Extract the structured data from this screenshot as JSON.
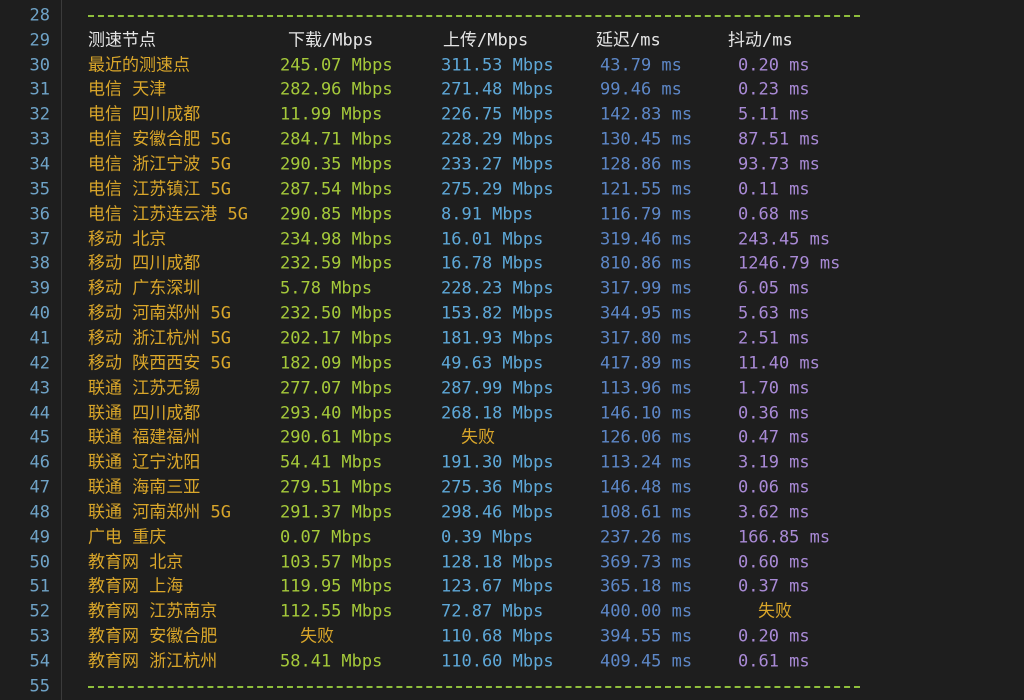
{
  "header": {
    "line": "29",
    "node": "测速节点",
    "download": "下载/Mbps",
    "upload": "上传/Mbps",
    "latency": "延迟/ms",
    "jitter": "抖动/ms"
  },
  "separator_lines": [
    "28",
    "55"
  ],
  "rows": [
    {
      "line": "30",
      "node": "最近的测速点",
      "download": "245.07 Mbps",
      "upload": "311.53 Mbps",
      "latency": "43.79 ms",
      "jitter": "0.20 ms"
    },
    {
      "line": "31",
      "node": "电信 天津",
      "download": "282.96 Mbps",
      "upload": "271.48 Mbps",
      "latency": "99.46 ms",
      "jitter": "0.23 ms"
    },
    {
      "line": "32",
      "node": "电信 四川成都",
      "download": "11.99 Mbps",
      "upload": "226.75 Mbps",
      "latency": "142.83 ms",
      "jitter": "5.11 ms"
    },
    {
      "line": "33",
      "node": "电信 安徽合肥 5G",
      "download": "284.71 Mbps",
      "upload": "228.29 Mbps",
      "latency": "130.45 ms",
      "jitter": "87.51 ms"
    },
    {
      "line": "34",
      "node": "电信 浙江宁波 5G",
      "download": "290.35 Mbps",
      "upload": "233.27 Mbps",
      "latency": "128.86 ms",
      "jitter": "93.73 ms"
    },
    {
      "line": "35",
      "node": "电信 江苏镇江 5G",
      "download": "287.54 Mbps",
      "upload": "275.29 Mbps",
      "latency": "121.55 ms",
      "jitter": "0.11 ms"
    },
    {
      "line": "36",
      "node": "电信 江苏连云港 5G",
      "download": "290.85 Mbps",
      "upload": "8.91 Mbps",
      "latency": "116.79 ms",
      "jitter": "0.68 ms"
    },
    {
      "line": "37",
      "node": "移动 北京",
      "download": "234.98 Mbps",
      "upload": "16.01 Mbps",
      "latency": "319.46 ms",
      "jitter": "243.45 ms"
    },
    {
      "line": "38",
      "node": "移动 四川成都",
      "download": "232.59 Mbps",
      "upload": "16.78 Mbps",
      "latency": "810.86 ms",
      "jitter": "1246.79 ms"
    },
    {
      "line": "39",
      "node": "移动 广东深圳",
      "download": "5.78 Mbps",
      "upload": "228.23 Mbps",
      "latency": "317.99 ms",
      "jitter": "6.05 ms"
    },
    {
      "line": "40",
      "node": "移动 河南郑州 5G",
      "download": "232.50 Mbps",
      "upload": "153.82 Mbps",
      "latency": "344.95 ms",
      "jitter": "5.63 ms"
    },
    {
      "line": "41",
      "node": "移动 浙江杭州 5G",
      "download": "202.17 Mbps",
      "upload": "181.93 Mbps",
      "latency": "317.80 ms",
      "jitter": "2.51 ms"
    },
    {
      "line": "42",
      "node": "移动 陕西西安 5G",
      "download": "182.09 Mbps",
      "upload": "49.63 Mbps",
      "latency": "417.89 ms",
      "jitter": "11.40 ms"
    },
    {
      "line": "43",
      "node": "联通 江苏无锡",
      "download": "277.07 Mbps",
      "upload": "287.99 Mbps",
      "latency": "113.96 ms",
      "jitter": "1.70 ms"
    },
    {
      "line": "44",
      "node": "联通 四川成都",
      "download": "293.40 Mbps",
      "upload": "268.18 Mbps",
      "latency": "146.10 ms",
      "jitter": "0.36 ms"
    },
    {
      "line": "45",
      "node": "联通 福建福州",
      "download": "290.61 Mbps",
      "upload": "失败",
      "latency": "126.06 ms",
      "jitter": "0.47 ms"
    },
    {
      "line": "46",
      "node": "联通 辽宁沈阳",
      "download": "54.41 Mbps",
      "upload": "191.30 Mbps",
      "latency": "113.24 ms",
      "jitter": "3.19 ms"
    },
    {
      "line": "47",
      "node": "联通 海南三亚",
      "download": "279.51 Mbps",
      "upload": "275.36 Mbps",
      "latency": "146.48 ms",
      "jitter": "0.06 ms"
    },
    {
      "line": "48",
      "node": "联通 河南郑州 5G",
      "download": "291.37 Mbps",
      "upload": "298.46 Mbps",
      "latency": "108.61 ms",
      "jitter": "3.62 ms"
    },
    {
      "line": "49",
      "node": "广电 重庆",
      "download": "0.07 Mbps",
      "upload": "0.39 Mbps",
      "latency": "237.26 ms",
      "jitter": "166.85 ms"
    },
    {
      "line": "50",
      "node": "教育网 北京",
      "download": "103.57 Mbps",
      "upload": "128.18 Mbps",
      "latency": "369.73 ms",
      "jitter": "0.60 ms"
    },
    {
      "line": "51",
      "node": "教育网 上海",
      "download": "119.95 Mbps",
      "upload": "123.67 Mbps",
      "latency": "365.18 ms",
      "jitter": "0.37 ms"
    },
    {
      "line": "52",
      "node": "教育网 江苏南京",
      "download": "112.55 Mbps",
      "upload": "72.87 Mbps",
      "latency": "400.00 ms",
      "jitter": "失败"
    },
    {
      "line": "53",
      "node": "教育网 安徽合肥",
      "download": "失败",
      "upload": "110.68 Mbps",
      "latency": "394.55 ms",
      "jitter": "0.20 ms"
    },
    {
      "line": "54",
      "node": "教育网 浙江杭州",
      "download": "58.41 Mbps",
      "upload": "110.60 Mbps",
      "latency": "409.45 ms",
      "jitter": "0.61 ms"
    }
  ],
  "colors": {
    "background": "#1e1e1e",
    "line_number": "#6fa3c7",
    "node": "#d9a62a",
    "download": "#a5c93a",
    "upload": "#5ea8d8",
    "latency": "#5d87c7",
    "jitter": "#a98ad6",
    "separator": "#8fbf3c"
  }
}
